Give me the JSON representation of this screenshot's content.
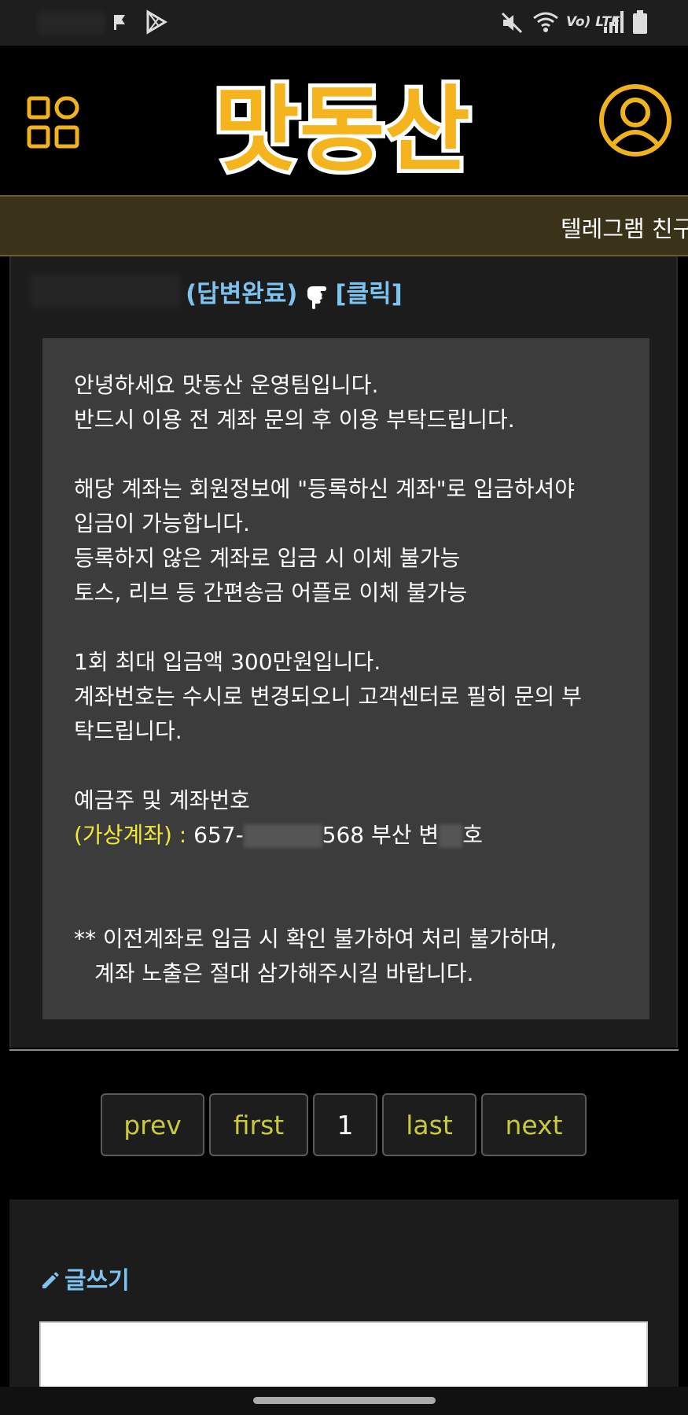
{
  "status_bar": {
    "icons": [
      "flag-icon",
      "play-store-icon",
      "mute-icon",
      "wifi-icon",
      "volte-icon",
      "signal-icon",
      "battery-icon"
    ],
    "volte_text": "Vo) LTE"
  },
  "header": {
    "logo_text": "맛동산",
    "logo_color": "#f5b41e",
    "menu_icon": "grid-menu-icon",
    "user_icon": "user-profile-icon"
  },
  "ticker": {
    "text": "텔레그램 친구"
  },
  "post": {
    "status_prefix": "(답변완료)",
    "status_suffix": "[클릭]",
    "lines": [
      "안녕하세요 맛동산 운영팀입니다.",
      "반드시 이용 전 계좌 문의 후 이용 부탁드립니다.",
      "해당 계좌는 회원정보에 \"등록하신 계좌\"로 입금하셔야",
      "입금이 가능합니다.",
      "등록하지 않은 계좌로 입금 시 이체 불가능",
      "토스, 리브 등 간편송금 어플로 이체 불가능",
      "1회 최대 입금액 300만원입니다.",
      "계좌번호는 수시로 변경되오니 고객센터로 필히 문의 부",
      "탁드립니다.",
      "예금주 및 계좌번호",
      "(가상계좌) : ",
      "657-",
      "568 부산 변",
      "호",
      "** 이전계좌로 입금 시 확인 불가하여 처리 불가하며,",
      "계좌 노출은 절대 삼가해주시길 바랍니다."
    ]
  },
  "pagination": {
    "prev": "prev",
    "first": "first",
    "current": "1",
    "last": "last",
    "next": "next"
  },
  "write": {
    "label": "글쓰기"
  },
  "colors": {
    "accent_blue": "#7cc3f0",
    "accent_yellow": "#f5e63a",
    "pager_text": "#c9c940"
  }
}
